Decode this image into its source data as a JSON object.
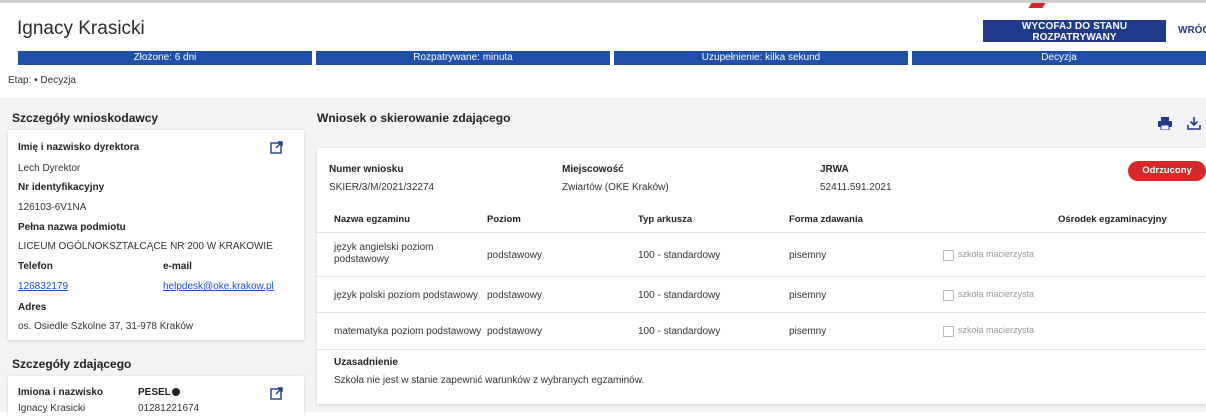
{
  "header": {
    "title": "Ignacy Krasicki",
    "primary_button": "WYCOFAJ DO STANU ROZPATRYWANY",
    "back_button": "WRÓĆ"
  },
  "stages": [
    "Złożone: 6 dni",
    "Rozpatrywane: minuta",
    "Uzupełnienie: kilka sekund",
    "Decyzja"
  ],
  "etap": "Etap: • Decyzja",
  "applicant": {
    "section_title": "Szczegóły wnioskodawcy",
    "director_label": "Imię i nazwisko dyrektora",
    "director_value": "Lech Dyrektor",
    "id_label": "Nr identyfikacyjny",
    "id_value": "126103-6V1NA",
    "entity_label": "Pełna nazwa podmiotu",
    "entity_value": "LICEUM OGÓLNOKSZTAŁCĄCE NR 200 W KRAKOWIE",
    "phone_label": "Telefon",
    "phone_value": "126832179",
    "email_label": "e-mail",
    "email_value": "helpdesk@oke.krakow.pl",
    "address_label": "Adres",
    "address_value": "os. Osiedle Szkolne 37, 31-978 Kraków"
  },
  "candidate": {
    "section_title": "Szczegóły zdającego",
    "name_label": "Imiona i nazwisko",
    "name_value": "Ignacy Krasicki",
    "pesel_label": "PESEL",
    "pesel_value": "01281221674"
  },
  "application": {
    "title": "Wniosek o skierowanie zdającego",
    "number_label": "Numer wniosku",
    "number_value": "SKIER/3/M/2021/32274",
    "city_label": "Miejscowość",
    "city_value": "Zwiartów (OKE Kraków)",
    "jrwa_label": "JRWA",
    "jrwa_value": "52411.591.2021",
    "status": "Odrzucony",
    "status_color": "#d62828",
    "columns": [
      "Nazwa egzaminu",
      "Poziom",
      "Typ arkusza",
      "Forma zdawania",
      "Ośrodek egzaminacyjny"
    ],
    "rows": [
      {
        "name": "język angielski poziom podstawowy",
        "level": "podstawowy",
        "type": "100 - standardowy",
        "form": "pisemny",
        "checkbox": "szkoła macierzysta"
      },
      {
        "name": "język polski poziom podstawowy",
        "level": "podstawowy",
        "type": "100 - standardowy",
        "form": "pisemny",
        "checkbox": "szkoła macierzysta"
      },
      {
        "name": "matematyka poziom podstawowy",
        "level": "podstawowy",
        "type": "100 - standardowy",
        "form": "pisemny",
        "checkbox": "szkoła macierzysta"
      }
    ],
    "justification_label": "Uzasadnienie",
    "justification_value": "Szkoła nie jest w stanie zapewnić warunków z wybranych egzaminów."
  },
  "colors": {
    "primary": "#1f3a8a",
    "stage": "#1f4fa8",
    "link": "#1a4fcf"
  }
}
